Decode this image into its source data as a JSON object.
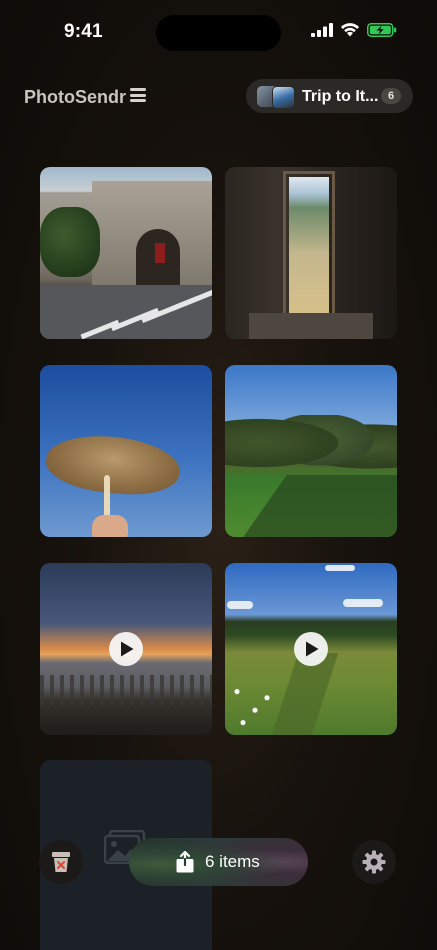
{
  "status_bar": {
    "time": "9:41",
    "icons": [
      "cellular-signal-icon",
      "wifi-icon",
      "battery-charging-icon"
    ],
    "battery_color": "#34c759"
  },
  "header": {
    "app_title": "PhotoSendr",
    "menu_icon": "hamburger-menu-icon",
    "album": {
      "name": "Trip to It...",
      "count": "6"
    }
  },
  "photos": [
    {
      "subject": "stone-archway-street",
      "type": "photo"
    },
    {
      "subject": "doorway-view",
      "type": "photo"
    },
    {
      "subject": "umbrella-sky",
      "type": "photo"
    },
    {
      "subject": "olive-grove",
      "type": "photo"
    },
    {
      "subject": "beach-sunset",
      "type": "video"
    },
    {
      "subject": "meadow-path",
      "type": "video"
    },
    {
      "subject": "placeholder",
      "type": "empty"
    }
  ],
  "bottom_bar": {
    "share_label": "6 items",
    "accent_color": "#2f4a38"
  }
}
